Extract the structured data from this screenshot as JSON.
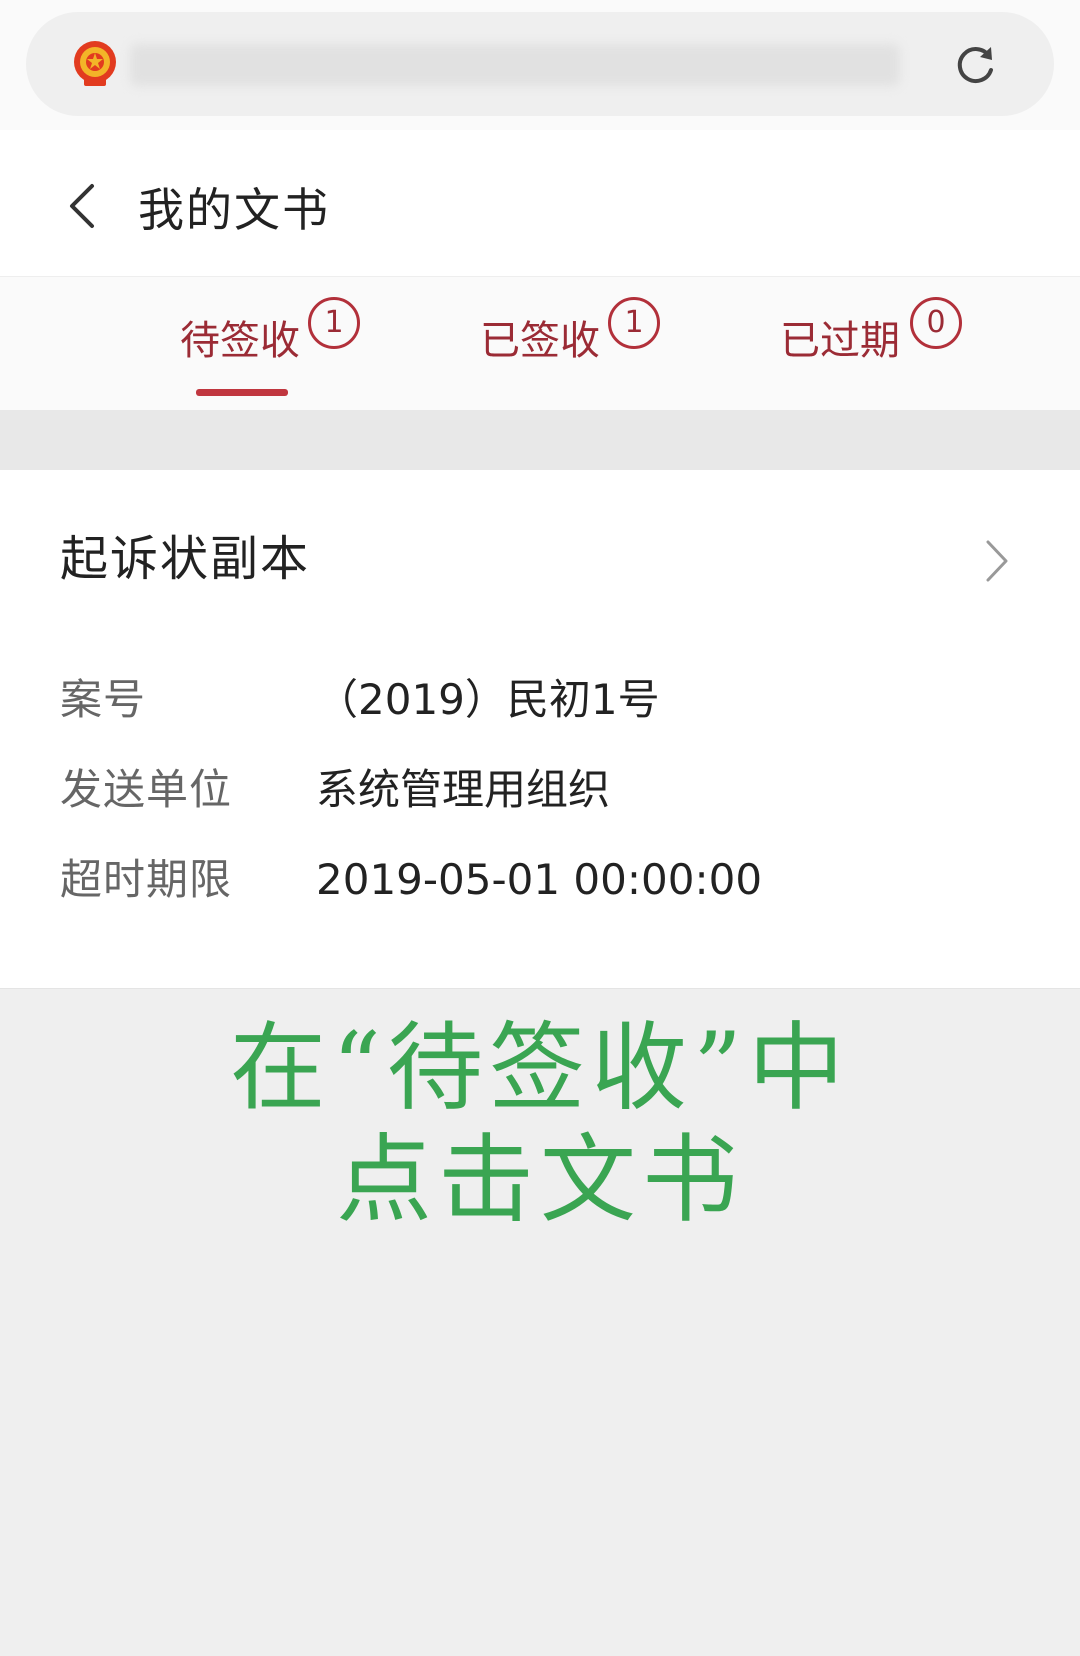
{
  "header": {
    "title": "我的文书"
  },
  "tabs": [
    {
      "label": "待签收",
      "count": "1",
      "active": true
    },
    {
      "label": "已签收",
      "count": "1",
      "active": false
    },
    {
      "label": "已过期",
      "count": "0",
      "active": false
    }
  ],
  "document": {
    "title": "起诉状副本",
    "fields": [
      {
        "label": "案号",
        "value": "（2019）民初1号"
      },
      {
        "label": "发送单位",
        "value": "系统管理用组织"
      },
      {
        "label": "超时期限",
        "value": "2019-05-01 00:00:00"
      }
    ]
  },
  "caption": {
    "line1": "在“待签收”中",
    "line2": "点击文书"
  },
  "colors": {
    "accent": "#b2303a",
    "caption": "#3aa552"
  },
  "icons": {
    "emblem": "national-emblem-icon",
    "reload": "reload-icon",
    "back": "back-arrow-icon",
    "chevron": "chevron-right-icon"
  }
}
